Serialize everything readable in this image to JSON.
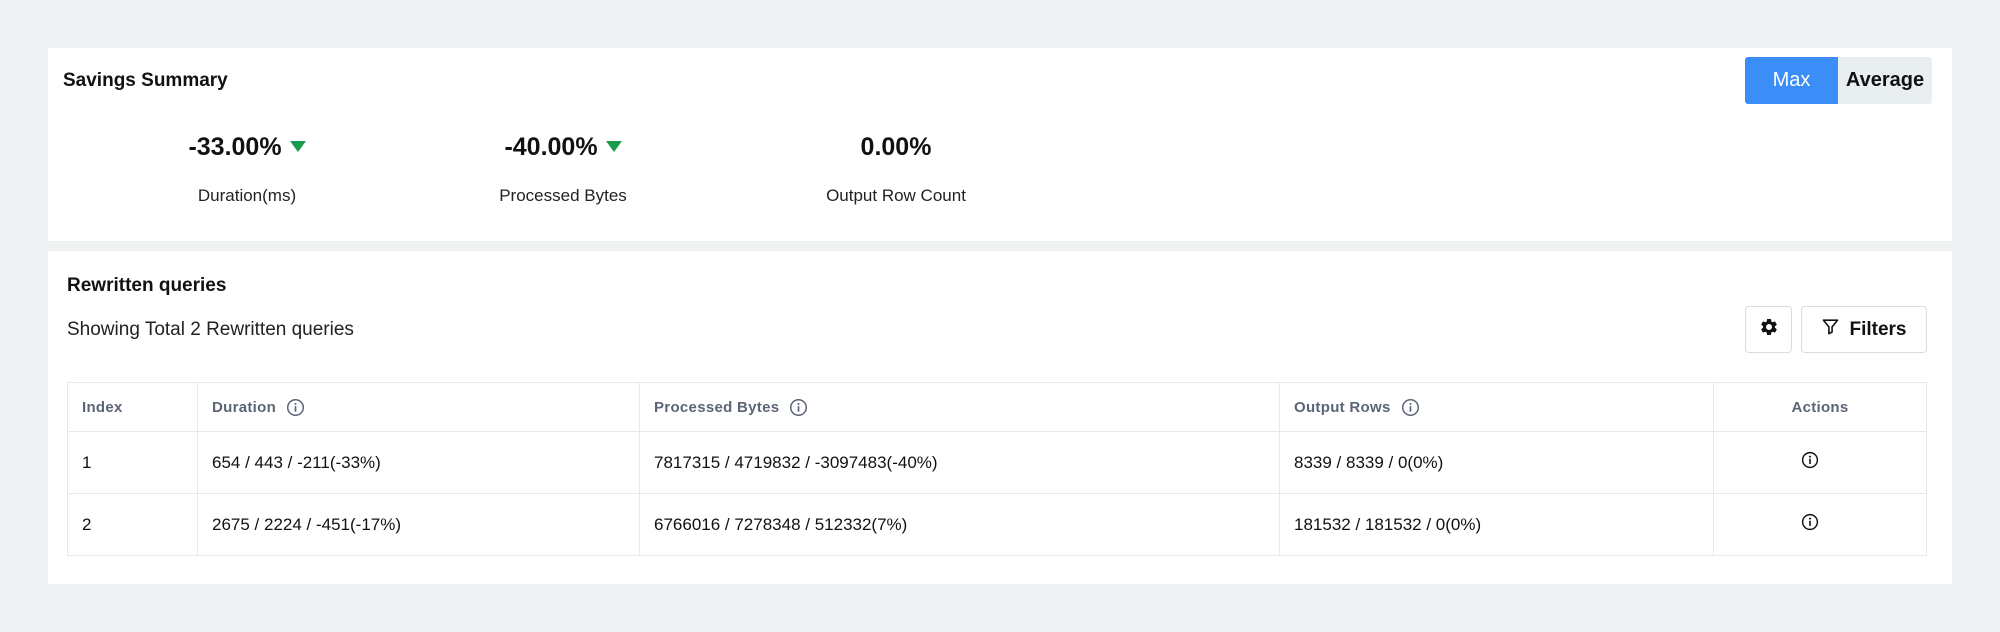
{
  "summary": {
    "title": "Savings Summary",
    "toggle": {
      "max_label": "Max",
      "average_label": "Average",
      "selected": "Max"
    },
    "metrics": [
      {
        "value": "-33.00%",
        "label": "Duration(ms)",
        "trend": "down"
      },
      {
        "value": "-40.00%",
        "label": "Processed Bytes",
        "trend": "down"
      },
      {
        "value": "0.00%",
        "label": "Output Row Count",
        "trend": "none"
      }
    ],
    "colors": {
      "accent": "#3b8df7",
      "trend_down": "#1a9a4f"
    }
  },
  "queries": {
    "title": "Rewritten queries",
    "subtitle": "Showing Total 2 Rewritten queries",
    "settings_icon": "gear-icon",
    "filters_label": "Filters",
    "filters_icon": "filter-icon",
    "columns": {
      "index": "Index",
      "duration": "Duration",
      "processed_bytes": "Processed Bytes",
      "output_rows": "Output Rows",
      "actions": "Actions"
    },
    "rows": [
      {
        "index": "1",
        "duration": "654 / 443 / -211(-33%)",
        "processed_bytes": "7817315 / 4719832 / -3097483(-40%)",
        "output_rows": "8339 / 8339 / 0(0%)",
        "action_icon": "info-icon"
      },
      {
        "index": "2",
        "duration": "2675 / 2224 / -451(-17%)",
        "processed_bytes": "6766016 / 7278348 / 512332(7%)",
        "output_rows": "181532 / 181532 / 0(0%)",
        "action_icon": "info-icon"
      }
    ]
  }
}
